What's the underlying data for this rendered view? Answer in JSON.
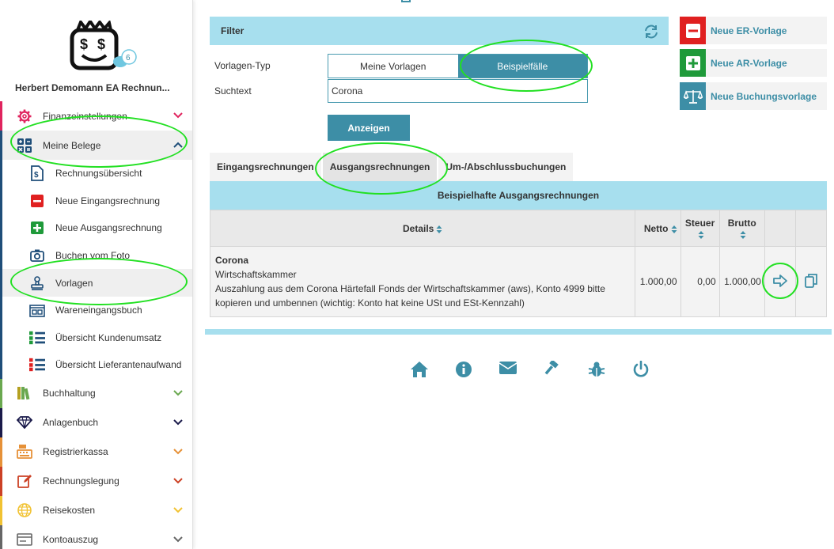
{
  "user": {
    "name": "Herbert Demomann EA Rechnun...",
    "chat_count": "6"
  },
  "sidebar": {
    "items": [
      {
        "label": "Finanzeinstellungen",
        "icon": "gear-icon",
        "color": "#e0245e"
      },
      {
        "label": "Meine Belege",
        "icon": "calculator-icon",
        "color": "#1f4e79",
        "expanded": true
      },
      {
        "label": "Buchhaltung",
        "icon": "books-icon",
        "color": "#6aa84f"
      },
      {
        "label": "Anlagenbuch",
        "icon": "diamond-icon",
        "color": "#1a1a4a"
      },
      {
        "label": "Registrierkassa",
        "icon": "cash-register-icon",
        "color": "#e69138"
      },
      {
        "label": "Rechnungslegung",
        "icon": "edit-icon",
        "color": "#cc4125"
      },
      {
        "label": "Reisekosten",
        "icon": "globe-icon",
        "color": "#f1c232"
      },
      {
        "label": "Kontoauszug",
        "icon": "card-icon",
        "color": "#666666"
      }
    ],
    "subitems": [
      {
        "label": "Rechnungsübersicht",
        "icon": "invoice-icon"
      },
      {
        "label": "Neue Eingangsrechnung",
        "icon": "minus-square-icon"
      },
      {
        "label": "Neue Ausgangsrechnung",
        "icon": "plus-square-icon"
      },
      {
        "label": "Buchen vom Foto",
        "icon": "camera-icon"
      },
      {
        "label": "Vorlagen",
        "icon": "stamp-icon"
      },
      {
        "label": "Wareneingangsbuch",
        "icon": "register-icon"
      },
      {
        "label": "Übersicht Kundenumsatz",
        "icon": "list-icon"
      },
      {
        "label": "Übersicht Lieferantenaufwand",
        "icon": "list-red-icon"
      }
    ]
  },
  "filter": {
    "title": "Filter",
    "type_label": "Vorlagen-Typ",
    "search_label": "Suchtext",
    "option_mine": "Meine Vorlagen",
    "option_examples": "Beispielfälle",
    "search_value": "Corona",
    "show_button": "Anzeigen"
  },
  "actions": {
    "er": "Neue ER-Vorlage",
    "ar": "Neue AR-Vorlage",
    "booking": "Neue Buchungsvorlage"
  },
  "tabs": [
    "Eingangsrechnungen",
    "Ausgangsrechnungen",
    "Um-/Abschlussbuchungen"
  ],
  "table": {
    "title": "Beispielhafte Ausgangsrechnungen",
    "headers": {
      "details": "Details",
      "netto": "Netto",
      "steuer": "Steuer",
      "brutto": "Brutto"
    },
    "rows": [
      {
        "name": "Corona",
        "org": "Wirtschaftskammer",
        "desc": "Auszahlung aus dem Corona Härtefall Fonds der Wirtschaftskammer (aws), Konto 4999 bitte kopieren und umbennen (wichtig: Konto hat keine USt und ESt-Kennzahl)",
        "netto": "1.000,00",
        "steuer": "0,00",
        "brutto": "1.000,00"
      }
    ]
  },
  "footer": [
    "home-icon",
    "info-icon",
    "mail-icon",
    "gavel-icon",
    "bug-icon",
    "power-icon"
  ],
  "colors": {
    "accent": "#3d8ea6",
    "light_accent": "#a7dfee",
    "highlight": "#22e022"
  }
}
